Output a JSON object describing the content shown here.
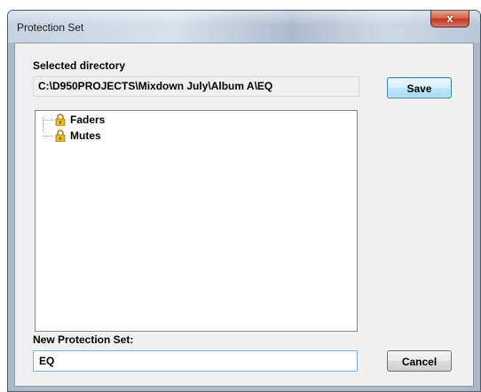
{
  "window": {
    "title": "Protection Set",
    "close_glyph": "x"
  },
  "selected_directory": {
    "label": "Selected directory",
    "value": "C:\\D950PROJECTS\\Mixdown July\\Album A\\EQ"
  },
  "buttons": {
    "save": "Save",
    "cancel": "Cancel"
  },
  "tree": {
    "items": [
      {
        "label": "Faders",
        "icon": "lock-icon"
      },
      {
        "label": "Mutes",
        "icon": "lock-icon"
      }
    ]
  },
  "new_protection_set": {
    "label": "New Protection Set:",
    "value": "EQ",
    "placeholder": ""
  },
  "colors": {
    "lock_gold": "#e8b830",
    "lock_shackle": "#b07a10",
    "close_red": "#c0391b",
    "default_button_border": "#3c7fb1"
  }
}
